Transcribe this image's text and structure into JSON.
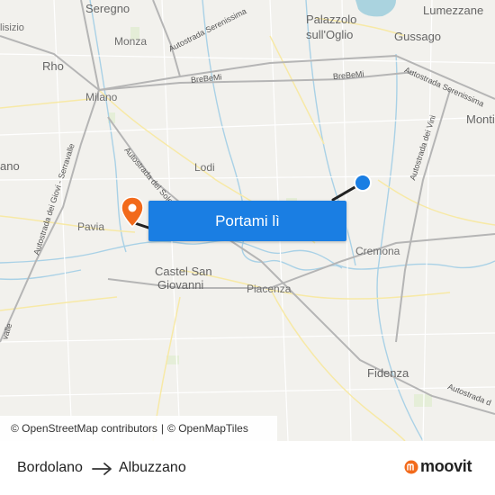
{
  "map": {
    "places": [
      {
        "id": "seregno",
        "label": "Seregno"
      },
      {
        "id": "monza",
        "label": "Monza"
      },
      {
        "id": "rho",
        "label": "Rho"
      },
      {
        "id": "milano",
        "label": "Milano"
      },
      {
        "id": "palazzolo",
        "label": "Palazzolo"
      },
      {
        "id": "sulloglio",
        "label": "sull'Oglio"
      },
      {
        "id": "lumezzane",
        "label": "Lumezzane"
      },
      {
        "id": "gussago",
        "label": "Gussago"
      },
      {
        "id": "lodi",
        "label": "Lodi"
      },
      {
        "id": "pavia",
        "label": "Pavia"
      },
      {
        "id": "cremona",
        "label": "Cremona"
      },
      {
        "id": "castel",
        "label": "Castel San"
      },
      {
        "id": "giovanni",
        "label": "Giovanni"
      },
      {
        "id": "piacenza",
        "label": "Piacenza"
      },
      {
        "id": "fidenza",
        "label": "Fidenza"
      },
      {
        "id": "montic",
        "label": "Montic"
      },
      {
        "id": "lisizio",
        "label": "lisizio"
      },
      {
        "id": "ano",
        "label": "ano"
      }
    ],
    "road_labels": [
      {
        "id": "serenissima1",
        "label": "Autostrada Serenissima"
      },
      {
        "id": "brebemi1",
        "label": "BreBeMi"
      },
      {
        "id": "brebemi2",
        "label": "BreBeMi"
      },
      {
        "id": "serenissima2",
        "label": "Autostrada Serenissima"
      },
      {
        "id": "vini",
        "label": "Autostrada dei Vini"
      },
      {
        "id": "sole",
        "label": "Autostrada del Sole"
      },
      {
        "id": "giovi",
        "label": "Autostrada dei Giovi - Serravalle"
      },
      {
        "id": "autostrada_fidenza",
        "label": "Autostrada d"
      },
      {
        "id": "valle",
        "label": "valle"
      }
    ],
    "origin_marker": {
      "icon": "current-location-dot-icon",
      "color": "#1a7ee3"
    },
    "destination_marker": {
      "icon": "destination-pin-icon",
      "color": "#f26a1b"
    },
    "route_color": "#222222"
  },
  "cta_button": {
    "label": "Portami lì",
    "color": "#1a7ee3"
  },
  "attribution": {
    "osm": "© OpenStreetMap contributors",
    "separator": "|",
    "omt": "© OpenMapTiles"
  },
  "footer": {
    "from": "Bordolano",
    "to": "Albuzzano",
    "arrow_icon": "arrow-right-icon",
    "brand": "moovit",
    "brand_color": "#f26a1b"
  }
}
